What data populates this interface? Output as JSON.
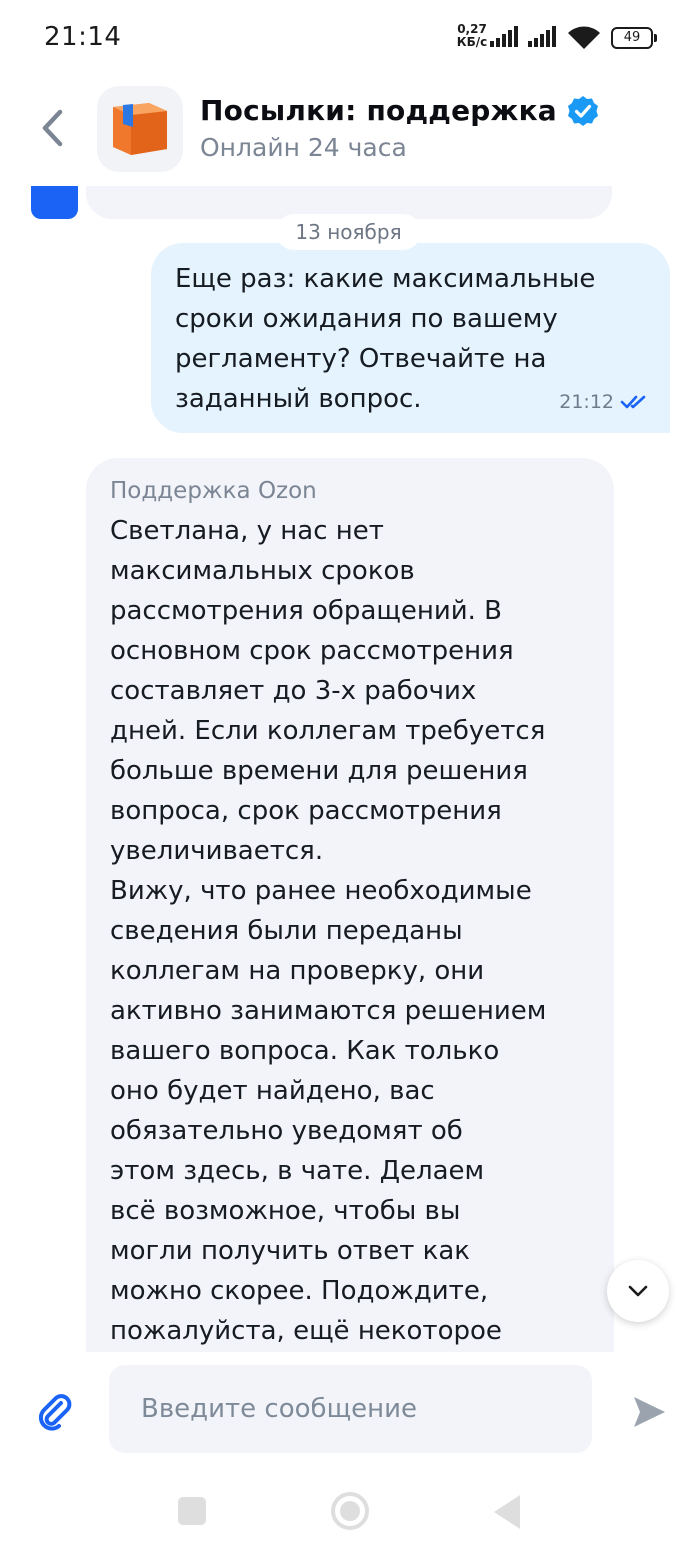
{
  "status_bar": {
    "time": "21:14",
    "net_speed_value": "0,27",
    "net_speed_unit": "КБ/с",
    "battery": "49"
  },
  "header": {
    "title": "Посылки: поддержка",
    "subtitle": "Онлайн 24 часа",
    "back_icon": "chevron-left-icon",
    "avatar_icon": "parcel-box-icon",
    "verified_icon": "verified-check-icon"
  },
  "chat": {
    "date_separator": "13 ноября",
    "outgoing": {
      "text": "Еще раз: какие максимальные сроки ожидания по вашему регламенту? Отвечайте на заданный вопрос.",
      "time": "21:12",
      "status_icon": "double-check-icon"
    },
    "incoming": {
      "sender": "Поддержка Ozon",
      "text": "Светлана, у нас нет\nмаксимальных сроков\nрассмотрения обращений. В\nосновном срок рассмотрения\nсоставляет до 3-х рабочих\nдней. Если коллегам требуется\nбольше времени для решения\nвопроса, срок рассмотрения\nувеличивается.\nВижу, что ранее необходимые\nсведения были переданы\nколлегам на проверку, они\nактивно занимаются решением\nвашего вопроса. Как только\nоно будет найдено, вас\nобязательно уведомят об\nэтом здесь, в чате. Делаем\nвсё возможное, чтобы вы\nмогли получить ответ как\nможно скорее. Подождите,\nпожалуйста, ещё некоторое"
    }
  },
  "composer": {
    "placeholder": "Введите сообщение",
    "attach_icon": "paperclip-icon",
    "send_icon": "send-icon"
  },
  "colors": {
    "accent": "#1a63f5",
    "outgoing_bubble": "#e4f3fe",
    "incoming_bubble": "#f2f4f9",
    "muted_text": "#7b8594"
  }
}
